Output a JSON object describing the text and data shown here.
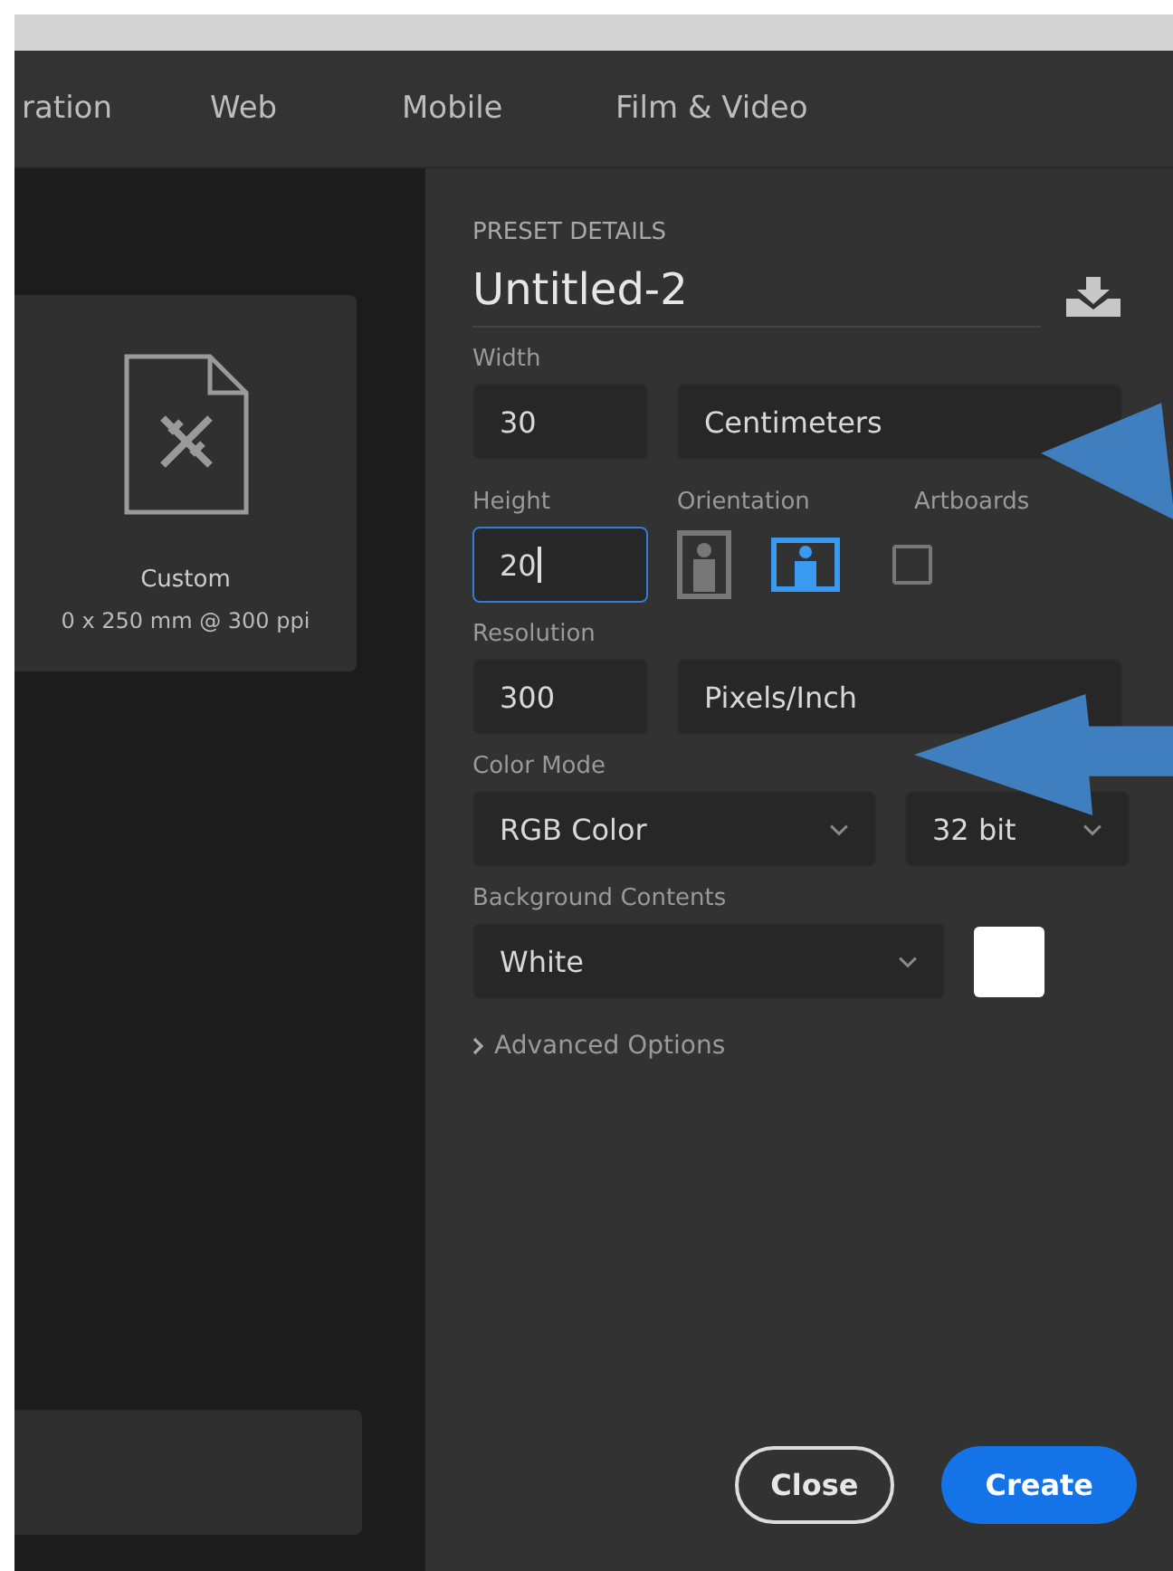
{
  "tabs": [
    {
      "label": "ration",
      "selected": false
    },
    {
      "label": "Web",
      "selected": false
    },
    {
      "label": "Mobile",
      "selected": false
    },
    {
      "label": "Film & Video",
      "selected": false
    }
  ],
  "preset_card": {
    "name": "Custom",
    "detail": "0 x 250 mm @ 300 ppi"
  },
  "preset_details": {
    "heading": "PRESET DETAILS",
    "name": "Untitled-2",
    "width": {
      "label": "Width",
      "value": "30",
      "unit": "Centimeters"
    },
    "height": {
      "label": "Height",
      "value": "20",
      "focused": true
    },
    "orientation": {
      "label": "Orientation",
      "options": [
        {
          "kind": "portrait",
          "selected": false
        },
        {
          "kind": "landscape",
          "selected": true
        }
      ]
    },
    "artboards": {
      "label": "Artboards",
      "checked": false
    },
    "resolution": {
      "label": "Resolution",
      "value": "300",
      "unit": "Pixels/Inch"
    },
    "color_mode": {
      "label": "Color Mode",
      "mode": "RGB Color",
      "depth": "32 bit"
    },
    "background": {
      "label": "Background Contents",
      "value": "White",
      "color": "#ffffff"
    },
    "advanced": {
      "label": "Advanced Options",
      "expanded": false
    }
  },
  "buttons": [
    {
      "label": "Close",
      "kind": "secondary"
    },
    {
      "label": "Create",
      "kind": "primary"
    }
  ]
}
